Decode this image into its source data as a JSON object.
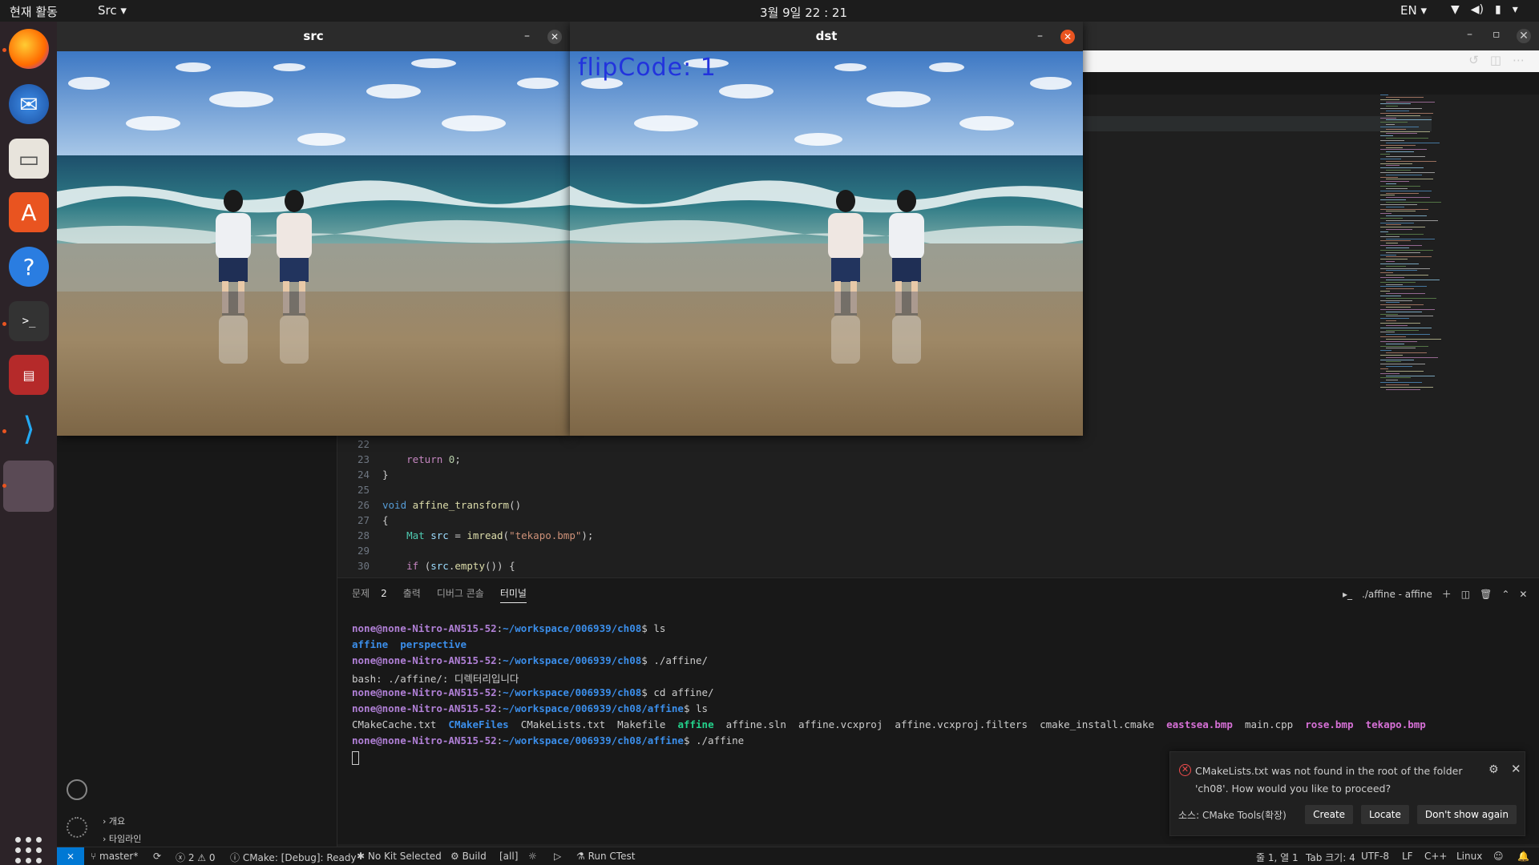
{
  "topbar": {
    "activities": "현재 활동",
    "app_menu": "Src ▾",
    "clock": "3월 9일  22 : 21",
    "lang": "EN ▾",
    "tray_icons": [
      "wifi-icon",
      "volume-icon",
      "battery-icon",
      "dropdown-icon"
    ]
  },
  "dock": {
    "items": [
      "firefox",
      "thunderbird",
      "files",
      "app-center",
      "help",
      "terminal",
      "app",
      "vscode"
    ]
  },
  "cv_windows": {
    "src": {
      "title": "src"
    },
    "dst": {
      "title": "dst",
      "overlay": "flipCode:  1"
    }
  },
  "editor": {
    "lines": [
      {
        "n": "22",
        "text": ""
      },
      {
        "n": "23",
        "text": "return 0;"
      },
      {
        "n": "24",
        "text": "}"
      },
      {
        "n": "25",
        "text": ""
      },
      {
        "n": "26",
        "text": "void affine_transform()"
      },
      {
        "n": "27",
        "text": "{"
      },
      {
        "n": "28",
        "text": "Mat src = imread(\"tekapo.bmp\");"
      },
      {
        "n": "29",
        "text": ""
      },
      {
        "n": "30",
        "text": "if (src.empty()) {"
      }
    ]
  },
  "panel": {
    "tabs": [
      "문제",
      "출력",
      "디버그 콘솔",
      "터미널"
    ],
    "problems_count": "2",
    "terminal_name": "./affine - affine"
  },
  "terminal": {
    "user": "none@none-Nitro-AN515-52",
    "lines": [
      {
        "path": "~/workspace/006939/ch08",
        "cmd": "ls"
      },
      {
        "out_dirs": [
          "affine",
          "perspective"
        ]
      },
      {
        "path": "~/workspace/006939/ch08",
        "cmd": "./affine/"
      },
      {
        "out": "bash: ./affine/: 디렉터리입니다"
      },
      {
        "path": "~/workspace/006939/ch08",
        "cmd": "cd affine/"
      },
      {
        "path": "~/workspace/006939/ch08/affine",
        "cmd": "ls"
      },
      {
        "files": [
          "CMakeCache.txt",
          "CMakeFiles",
          "CMakeLists.txt",
          "Makefile",
          "affine",
          "affine.sln",
          "affine.vcxproj",
          "affine.vcxproj.filters",
          "cmake_install.cmake",
          "eastsea.bmp",
          "main.cpp",
          "rose.bmp",
          "tekapo.bmp"
        ]
      },
      {
        "path": "~/workspace/006939/ch08/affine",
        "cmd": "./affine"
      }
    ]
  },
  "sidebar": {
    "outline": "개요",
    "timeline": "타임라인"
  },
  "notification": {
    "message": "CMakeLists.txt was not found in the root of the folder 'ch08'. How would you like to proceed?",
    "source": "소스: CMake Tools(확장)",
    "buttons": [
      "Create",
      "Locate",
      "Don't show again"
    ]
  },
  "statusbar": {
    "branch": "master*",
    "errors": "2",
    "warnings": "0",
    "cmake": "CMake: [Debug]: Ready",
    "kit": "No Kit Selected",
    "build": "Build",
    "target": "[all]",
    "ctest": "Run CTest",
    "position": "줄 1, 열 1",
    "tab": "Tab 크기: 4",
    "encoding": "UTF-8",
    "eol": "LF",
    "lang": "C++",
    "os": "Linux"
  },
  "colors": {
    "ubuntu_orange": "#e95420",
    "vscode_blue": "#0078d4",
    "overlay_text": "#2233dd"
  }
}
